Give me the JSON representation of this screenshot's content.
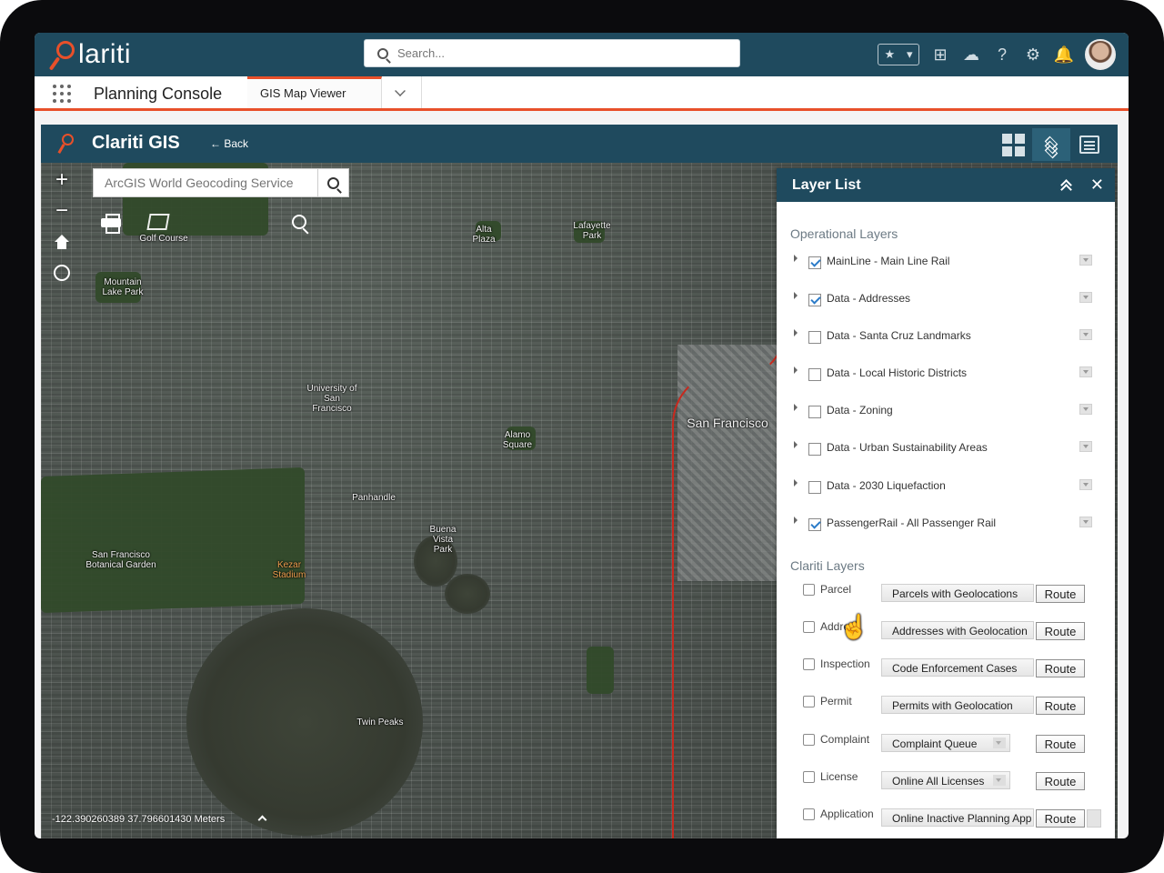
{
  "header": {
    "brand": "lariti",
    "search_placeholder": "Search...",
    "icons": [
      "favorites-star-icon",
      "add-icon",
      "setup-cloud-icon",
      "help-icon",
      "gear-icon",
      "bell-icon"
    ]
  },
  "nav": {
    "app_name": "Planning Console",
    "tab_label": "GIS Map Viewer"
  },
  "gis": {
    "title": "Clariti GIS",
    "back_label": "← Back",
    "geocoder_placeholder": "ArcGIS World Geocoding Service",
    "coordinates": "-122.390260389 37.796601430 Meters"
  },
  "map_labels": [
    "Mountain Lake Park",
    "Golf Course",
    "Alta Plaza",
    "Lafayette Park",
    "University of San Francisco",
    "San Francisco",
    "Alamo Square",
    "Panhandle",
    "Buena Vista Park",
    "San Francisco Botanical Garden",
    "Kezar Stadium",
    "Twin Peaks"
  ],
  "layer_list": {
    "title": "Layer List",
    "operational_title": "Operational Layers",
    "operational_layers": [
      {
        "label": "MainLine - Main Line Rail",
        "checked": true
      },
      {
        "label": "Data - Addresses",
        "checked": true
      },
      {
        "label": "Data - Santa Cruz Landmarks",
        "checked": false
      },
      {
        "label": "Data - Local Historic Districts",
        "checked": false
      },
      {
        "label": "Data - Zoning",
        "checked": false
      },
      {
        "label": "Data - Urban Sustainability Areas",
        "checked": false
      },
      {
        "label": "Data - 2030 Liquefaction",
        "checked": false
      },
      {
        "label": "PassengerRail - All Passenger Rail",
        "checked": true
      }
    ],
    "clariti_title": "Clariti Layers",
    "clariti_layers": [
      {
        "label": "Parcel",
        "selected": "Parcels with Geolocations",
        "route": "Route"
      },
      {
        "label": "Address",
        "selected": "Addresses with Geolocation",
        "route": "Route"
      },
      {
        "label": "Inspection",
        "selected": "Code Enforcement Cases",
        "route": "Route"
      },
      {
        "label": "Permit",
        "selected": "Permits with Geolocation",
        "route": "Route"
      },
      {
        "label": "Complaint",
        "selected": "Complaint Queue",
        "route": "Route"
      },
      {
        "label": "License",
        "selected": "Online All Licenses",
        "route": "Route"
      },
      {
        "label": "Application",
        "selected": "Online Inactive Planning App",
        "route": "Route"
      }
    ]
  },
  "colors": {
    "header_bg": "#1f4a5e",
    "accent": "#e8502a",
    "rail": "#c8291e",
    "checkbox_check": "#2b7bc8"
  }
}
